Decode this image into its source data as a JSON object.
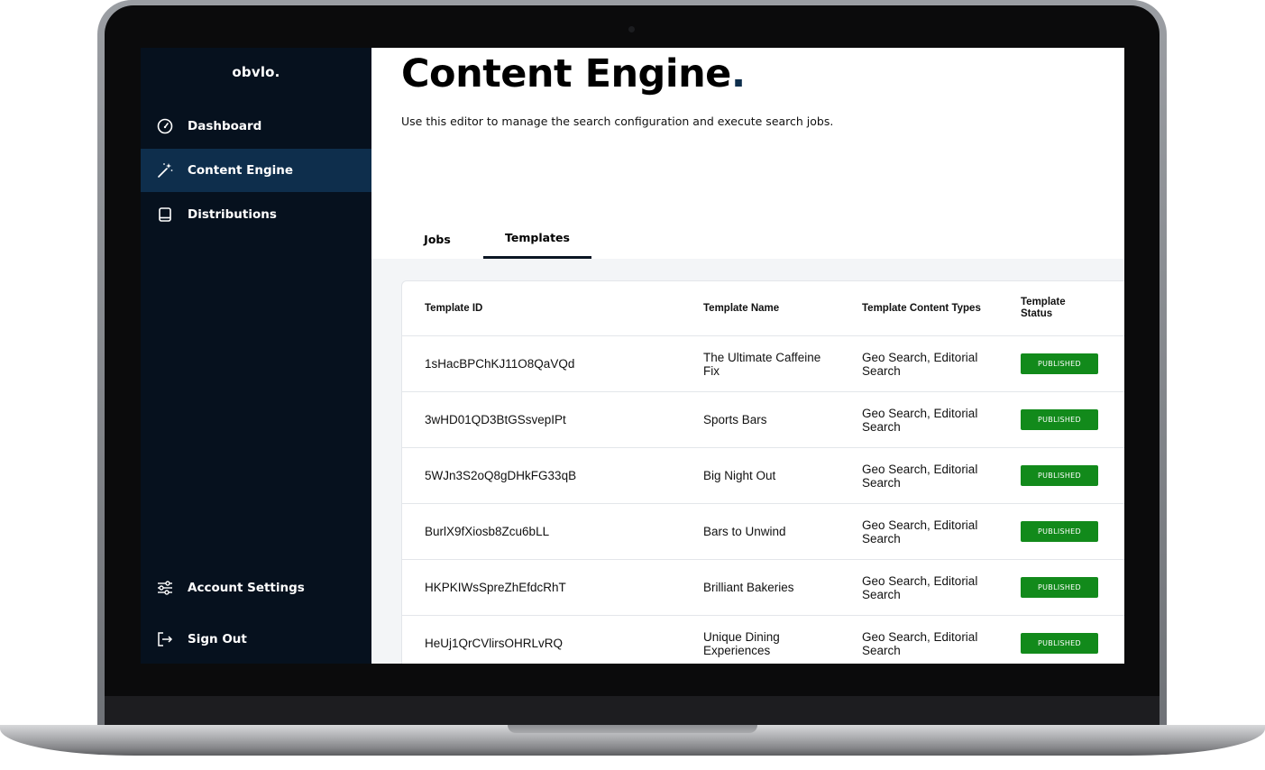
{
  "app": {
    "logo": "obvlo."
  },
  "sidebar": {
    "items": [
      {
        "label": "Dashboard",
        "icon": "gauge-icon",
        "active": false
      },
      {
        "label": "Content Engine",
        "icon": "magic-wand-icon",
        "active": true
      },
      {
        "label": "Distributions",
        "icon": "book-icon",
        "active": false
      }
    ],
    "bottom_items": [
      {
        "label": "Account Settings",
        "icon": "sliders-icon"
      },
      {
        "label": "Sign Out",
        "icon": "sign-out-icon"
      }
    ]
  },
  "main": {
    "title": "Content Engine",
    "title_dot": ".",
    "subtitle": "Use this editor to manage the search configuration and execute search jobs.",
    "tabs": [
      {
        "label": "Jobs",
        "active": false
      },
      {
        "label": "Templates",
        "active": true
      }
    ]
  },
  "table": {
    "columns": [
      "Template ID",
      "Template Name",
      "Template Content Types",
      "Template Status"
    ],
    "rows": [
      {
        "id": "1sHacBPChKJ11O8QaVQd",
        "name": "The Ultimate Caffeine Fix",
        "types": "Geo Search, Editorial Search",
        "status": "PUBLISHED"
      },
      {
        "id": "3wHD01QD3BtGSsvepIPt",
        "name": "Sports Bars",
        "types": "Geo Search, Editorial Search",
        "status": "PUBLISHED"
      },
      {
        "id": "5WJn3S2oQ8gDHkFG33qB",
        "name": "Big Night Out",
        "types": "Geo Search, Editorial Search",
        "status": "PUBLISHED"
      },
      {
        "id": "BurlX9fXiosb8Zcu6bLL",
        "name": "Bars to Unwind",
        "types": "Geo Search, Editorial Search",
        "status": "PUBLISHED"
      },
      {
        "id": "HKPKIWsSpreZhEfdcRhT",
        "name": "Brilliant Bakeries",
        "types": "Geo Search, Editorial Search",
        "status": "PUBLISHED"
      },
      {
        "id": "HeUj1QrCVlirsOHRLvRQ",
        "name": "Unique Dining Experiences",
        "types": "Geo Search, Editorial Search",
        "status": "PUBLISHED"
      }
    ]
  },
  "colors": {
    "sidebar_bg": "#06111e",
    "sidebar_active": "#0e2e4c",
    "badge_green": "#128a1b",
    "content_bg": "#f3f5f7"
  }
}
